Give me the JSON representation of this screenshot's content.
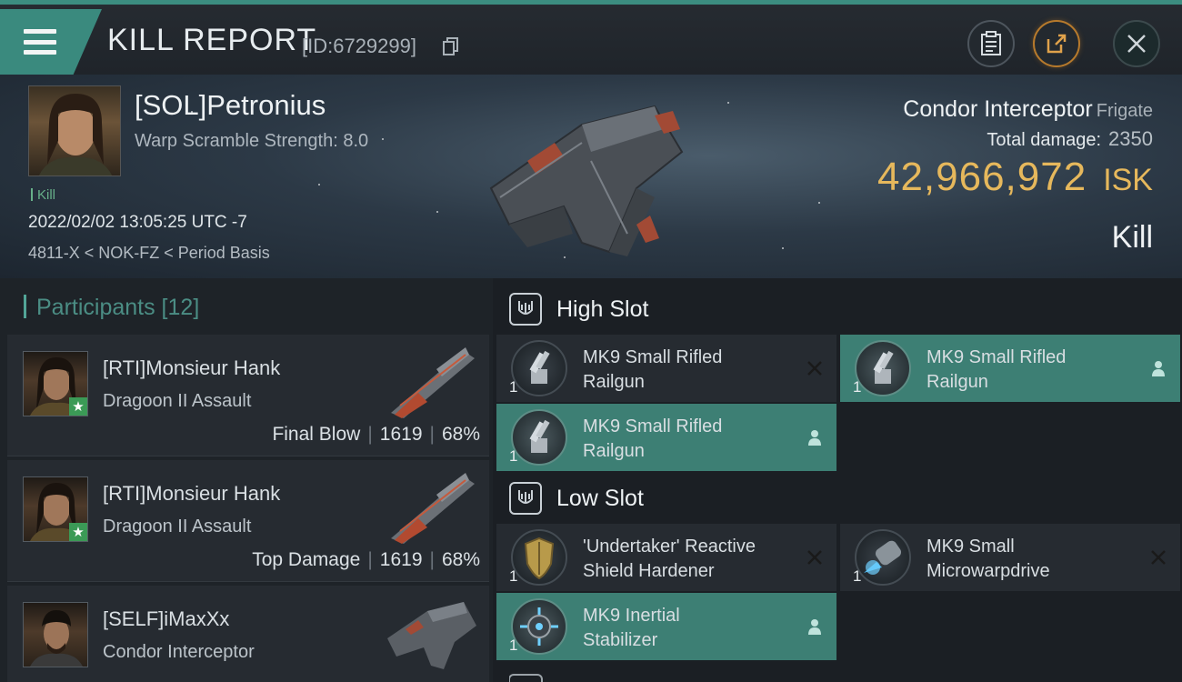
{
  "header": {
    "title": "KILL REPORT",
    "report_id": "[ID:6729299]"
  },
  "victim": {
    "name": "[SOL]Petronius",
    "warp_scramble": "Warp Scramble Strength: 8.0",
    "tag": "Kill",
    "datetime": "2022/02/02 13:05:25 UTC -7",
    "location": "4811-X < NOK-FZ < Period Basis",
    "ship_name": "Condor Interceptor",
    "ship_class": "Frigate",
    "total_damage_label": "Total damage:",
    "total_damage": "2350",
    "isk_value": "42,966,972",
    "isk_unit": "ISK",
    "result": "Kill"
  },
  "participants": {
    "title": "Participants [12]",
    "items": [
      {
        "name": "[RTI]Monsieur Hank",
        "ship": "Dragoon II Assault",
        "role": "Final Blow",
        "damage": "1619",
        "percent": "68%",
        "starred": true
      },
      {
        "name": "[RTI]Monsieur Hank",
        "ship": "Dragoon II Assault",
        "role": "Top Damage",
        "damage": "1619",
        "percent": "68%",
        "starred": true
      },
      {
        "name": "[SELF]iMaxXx",
        "ship": "Condor Interceptor",
        "role": "",
        "damage": "",
        "percent": "",
        "starred": false
      }
    ]
  },
  "fitting": {
    "high_slot_label": "High Slot",
    "low_slot_label": "Low Slot",
    "high": [
      {
        "qty": "1",
        "line1": "MK9 Small Rifled",
        "line2": "Railgun",
        "status": "destroyed"
      },
      {
        "qty": "1",
        "line1": "MK9 Small Rifled",
        "line2": "Railgun",
        "status": "dropped"
      },
      {
        "qty": "1",
        "line1": "MK9 Small Rifled",
        "line2": "Railgun",
        "status": "dropped"
      }
    ],
    "low": [
      {
        "qty": "1",
        "line1": "'Undertaker' Reactive",
        "line2": " Shield Hardener",
        "status": "destroyed"
      },
      {
        "qty": "1",
        "line1": "MK9 Small",
        "line2": "Microwarpdrive",
        "status": "destroyed"
      },
      {
        "qty": "1",
        "line1": "MK9 Inertial",
        "line2": "Stabilizer",
        "status": "dropped"
      }
    ]
  }
}
